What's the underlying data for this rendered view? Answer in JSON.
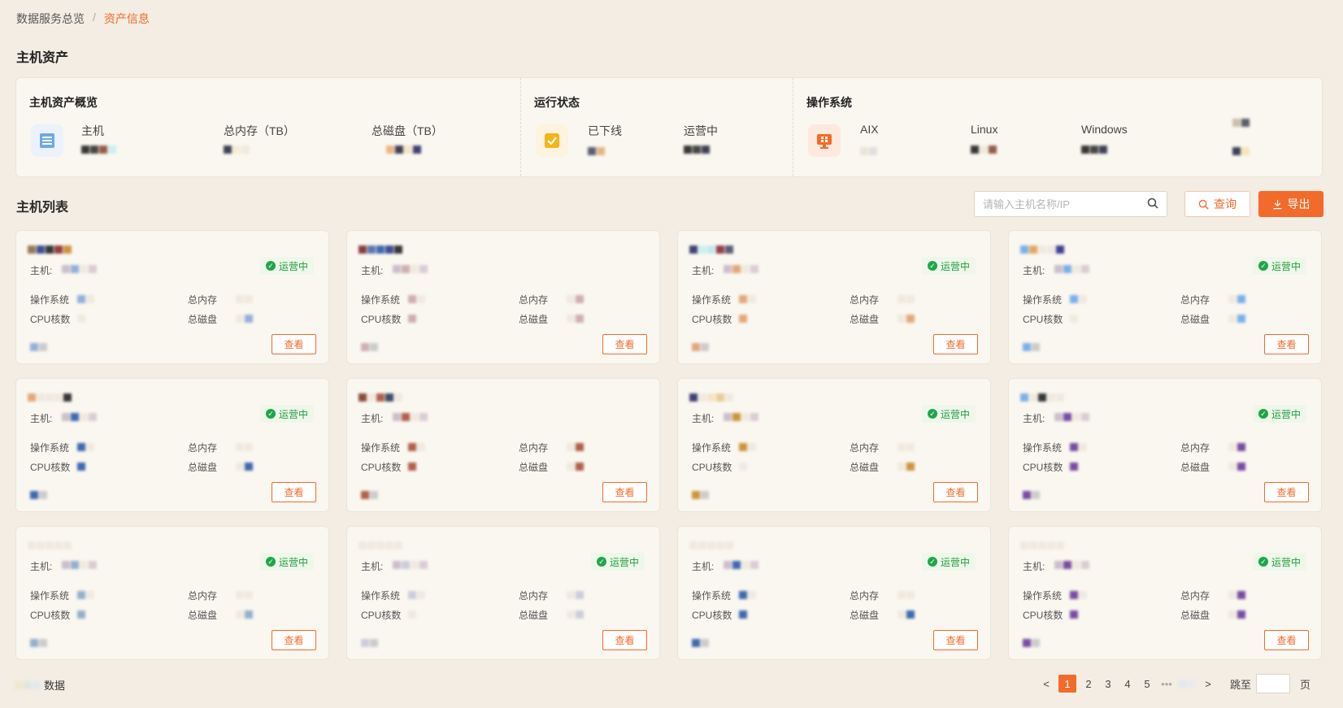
{
  "breadcrumb": {
    "parent": "数据服务总览",
    "separator": "/",
    "current": "资产信息"
  },
  "section_title": "主机资产",
  "overview": {
    "host_block": {
      "title": "主机资产概览",
      "stats": [
        "主机",
        "总内存（TB）",
        "总磁盘（TB）"
      ]
    },
    "run_block": {
      "title": "运行状态",
      "stats": [
        "已下线",
        "运营中"
      ]
    },
    "os_block": {
      "title": "操作系统",
      "stats": [
        "AIX",
        "Linux",
        "Windows"
      ]
    }
  },
  "list": {
    "title": "主机列表",
    "search_placeholder": "请输入主机名称/IP",
    "query_label": "查询",
    "export_label": "导出"
  },
  "card_labels": {
    "host": "主机:",
    "os": "操作系统",
    "cpu": "CPU核数",
    "mem": "总内存",
    "disk": "总磁盘",
    "status": "运营中",
    "view": "查看"
  },
  "cards": [
    {
      "status": "运营中"
    },
    {
      "status": ""
    },
    {
      "status": "运营中"
    },
    {
      "status": "运营中"
    },
    {
      "status": "运营中"
    },
    {
      "status": ""
    },
    {
      "status": "运营中"
    },
    {
      "status": "运营中"
    },
    {
      "status": "运营中"
    },
    {
      "status": "运营中"
    },
    {
      "status": "运营中"
    },
    {
      "status": "运营中"
    }
  ],
  "footer": {
    "total_suffix": "数据",
    "jump_label": "跳至",
    "page_suffix": "页"
  },
  "pagination": {
    "pages": [
      "1",
      "2",
      "3",
      "4",
      "5"
    ],
    "active": "1",
    "ellipsis": "•••",
    "prev": "<",
    "next": ">"
  },
  "colors": {
    "accent": "#f26b2a",
    "success": "#1f9e3a",
    "background": "#f3ede3"
  }
}
